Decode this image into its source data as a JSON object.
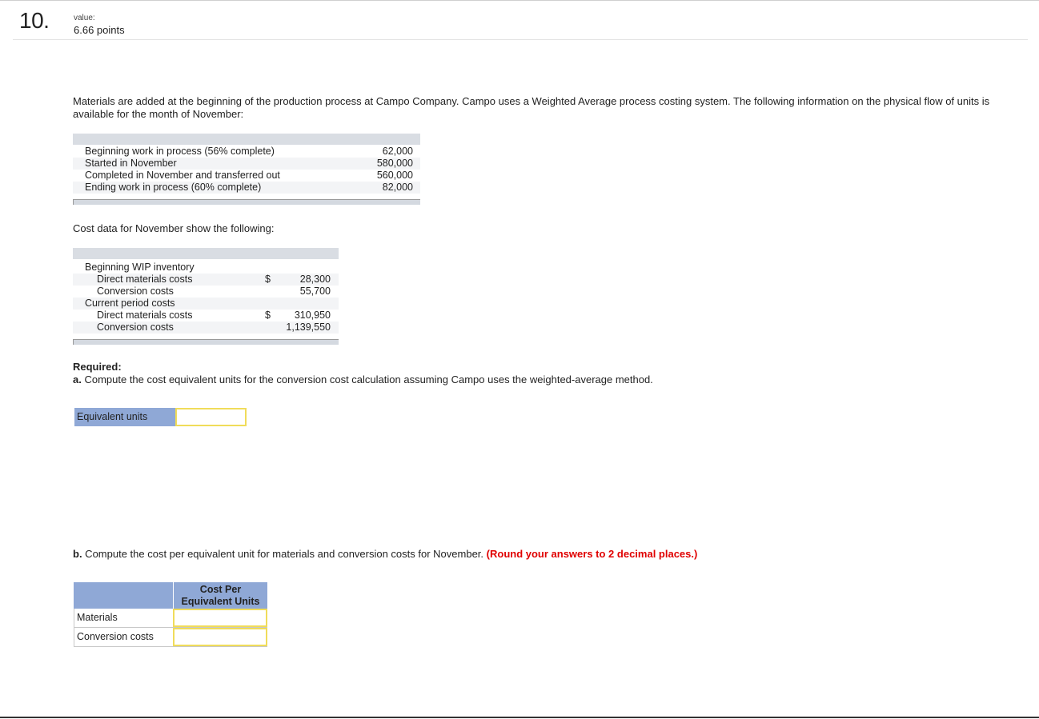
{
  "question": {
    "number": "10.",
    "value_label": "value:",
    "points": "6.66 points"
  },
  "intro": "Materials are added at the beginning of the production process at Campo Company. Campo uses a Weighted Average process costing system. The following information on the physical flow of units is available for the month of November:",
  "units_table": {
    "rows": [
      {
        "label": "Beginning work in process (56% complete)",
        "value": "62,000"
      },
      {
        "label": "Started in November",
        "value": "580,000"
      },
      {
        "label": "Completed in November and transferred out",
        "value": "560,000"
      },
      {
        "label": "Ending work in process (60% complete)",
        "value": "82,000"
      }
    ]
  },
  "cost_intro": "Cost data for November show the following:",
  "cost_table": {
    "rows": [
      {
        "label": "Beginning WIP inventory",
        "dollar": "",
        "value": ""
      },
      {
        "label": "Direct materials costs",
        "dollar": "$",
        "value": "28,300"
      },
      {
        "label": "Conversion costs",
        "dollar": "",
        "value": "55,700"
      },
      {
        "label": "Current period costs",
        "dollar": "",
        "value": ""
      },
      {
        "label": "Direct materials costs",
        "dollar": "$",
        "value": "310,950"
      },
      {
        "label": "Conversion costs",
        "dollar": "",
        "value": "1,139,550"
      }
    ]
  },
  "required": {
    "heading": "Required:",
    "part_a_prefix": "a.",
    "part_a_text": " Compute the cost equivalent units for the conversion cost calculation assuming Campo uses the weighted-average method."
  },
  "equivalent_units": {
    "label": "Equivalent units",
    "value": ""
  },
  "part_b": {
    "prefix": "b.",
    "text": " Compute the cost per equivalent unit for materials and conversion costs for November. ",
    "note": "(Round your answers to 2 decimal places.)"
  },
  "cpe_table": {
    "header_line1": "Cost Per",
    "header_line2": "Equivalent Units",
    "rows": [
      {
        "label": "Materials",
        "value": ""
      },
      {
        "label": "Conversion costs",
        "value": ""
      }
    ]
  }
}
